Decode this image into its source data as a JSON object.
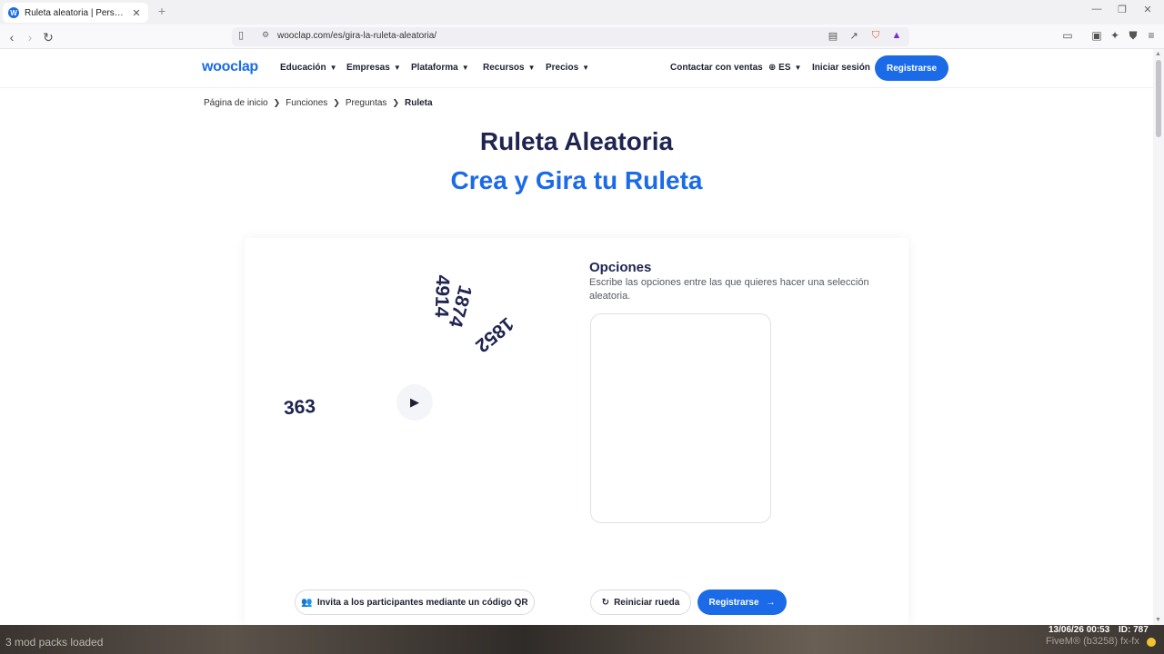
{
  "browser": {
    "tab_title": "Ruleta aleatoria | Personaliza y gira tu ruleta",
    "tab_favicon": "W",
    "url": "wooclap.com/es/gira-la-ruleta-aleatoria/"
  },
  "header": {
    "logo": "wooclap",
    "nav": [
      "Educación",
      "Empresas",
      "Plataforma",
      "Recursos",
      "Precios"
    ],
    "contact": "Contactar con ventas",
    "language": "ES",
    "login": "Iniciar sesión",
    "register": "Registrarse"
  },
  "breadcrumb": [
    "Página de inicio",
    "Funciones",
    "Preguntas",
    "Ruleta"
  ],
  "hero": {
    "title": "Ruleta Aleatoria",
    "subtitle": "Crea y Gira tu Ruleta"
  },
  "wheel": {
    "numbers": [
      "4914",
      "1874",
      "1852",
      "363"
    ]
  },
  "options": {
    "title": "Opciones",
    "description": "Escribe las opciones entre las que quieres hacer una selección aleatoria."
  },
  "actions": {
    "qr": "Invita a los participantes mediante un código QR",
    "reset": "Reiniciar rueda",
    "register": "Registrarse"
  },
  "overlay": {
    "left": "3 mod packs loaded",
    "date": "13/06/26 00:53",
    "id": "ID: 787",
    "build": "FiveM® (b3258) fx-fx"
  },
  "colors": {
    "brand_blue": "#1b6be8",
    "heading_navy": "#1f2450"
  }
}
